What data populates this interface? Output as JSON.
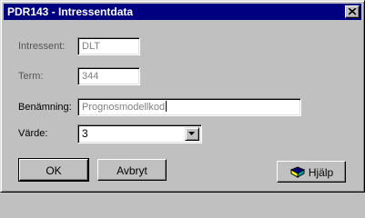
{
  "window": {
    "title": "PDR143 - Intressentdata"
  },
  "form": {
    "intressent": {
      "label": "Intressent:",
      "value": "DLT"
    },
    "term": {
      "label": "Term:",
      "value": "344"
    },
    "benamning": {
      "label": "Benämning:",
      "value": "Prognosmodellkod"
    },
    "varde": {
      "label": "Värde:",
      "value": "3"
    }
  },
  "buttons": {
    "ok": "OK",
    "cancel": "Avbryt",
    "help": "Hjälp"
  },
  "icons": {
    "close": "close-icon",
    "dropdown": "chevron-down-icon",
    "help": "help-book-icon"
  },
  "colors": {
    "titlebar": "#000080",
    "face": "#c0c0c0"
  }
}
